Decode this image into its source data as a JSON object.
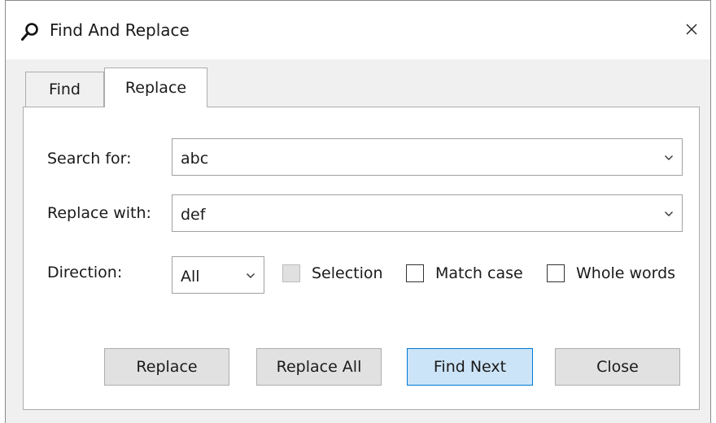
{
  "window": {
    "title": "Find And Replace"
  },
  "tabs": [
    {
      "label": "Find",
      "active": false
    },
    {
      "label": "Replace",
      "active": true
    }
  ],
  "search": {
    "label": "Search for:",
    "value": "abc"
  },
  "replace": {
    "label": "Replace with:",
    "value": "def"
  },
  "direction": {
    "label": "Direction:",
    "value": "All"
  },
  "options": {
    "selection": {
      "label": "Selection",
      "checked": false,
      "enabled": false
    },
    "match_case": {
      "label": "Match case",
      "checked": false
    },
    "whole_words": {
      "label": "Whole words",
      "checked": false
    }
  },
  "buttons": {
    "replace": "Replace",
    "replace_all": "Replace All",
    "find_next": "Find Next",
    "close": "Close"
  },
  "icons": {
    "title": "search-icon",
    "close": "close-icon",
    "dropdown": "chevron-down-icon"
  },
  "colors": {
    "accent": "#0078d4",
    "primary_button_bg": "#cce4f7",
    "dialog_bg": "#f0f0f0"
  }
}
